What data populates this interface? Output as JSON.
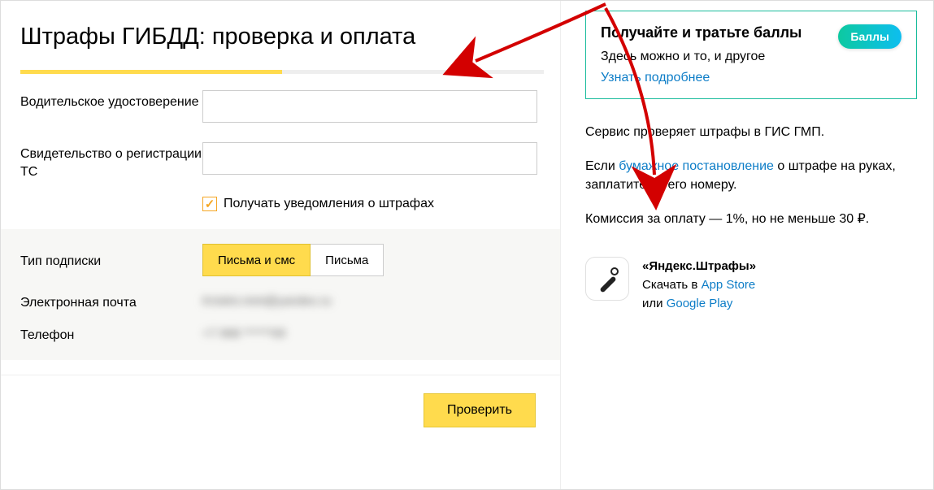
{
  "page": {
    "title": "Штрафы ГИБДД: проверка и оплата"
  },
  "form": {
    "license_label": "Водительское удостоверение",
    "license_value": "",
    "registration_label": "Свидетельство о регистрации ТС",
    "registration_value": "",
    "notify_label": "Получать уведомления о штрафах",
    "notify_checked": true,
    "subscription_label": "Тип подписки",
    "subscription_options": [
      "Письма и смс",
      "Письма"
    ],
    "subscription_selected": 0,
    "email_label": "Электронная почта",
    "email_value": "Kristini.mint@yandex.ru",
    "phone_label": "Телефон",
    "phone_value": "+7 968 ******09",
    "check_button": "Проверить"
  },
  "promo": {
    "title": "Получайте и тратьте баллы",
    "text": "Здесь можно и то, и другое",
    "link": "Узнать подробнее",
    "badge": "Баллы"
  },
  "info": {
    "p1": "Сервис проверяет штрафы в ГИС ГМП.",
    "p2_prefix": "Если ",
    "p2_link": "бумажное постановление",
    "p2_suffix": " о штрафе на руках, заплатите по его номеру.",
    "p3": "Комиссия за оплату — 1%, но не меньше 30 ₽."
  },
  "app": {
    "name": "«Яндекс.Штрафы»",
    "download_prefix": "Скачать в ",
    "appstore": "App Store",
    "or": "или ",
    "googleplay": "Google Play"
  }
}
